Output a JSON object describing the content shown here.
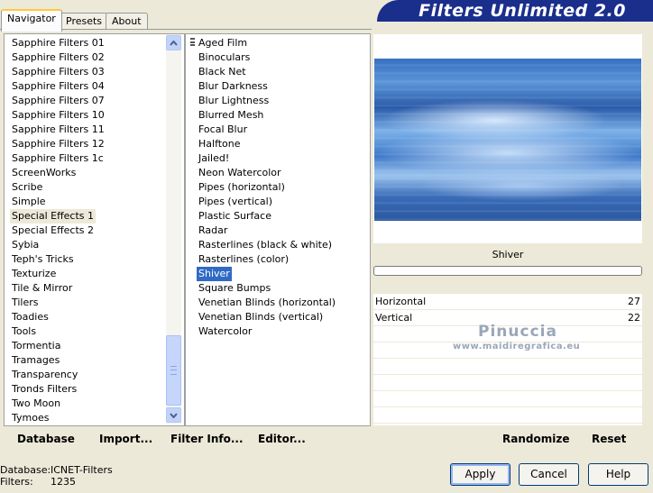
{
  "tabs": [
    {
      "label": "Navigator",
      "active": true
    },
    {
      "label": "Presets",
      "active": false
    },
    {
      "label": "About",
      "active": false
    }
  ],
  "banner_title": "Filters Unlimited 2.0",
  "categories": [
    "Sapphire Filters 01",
    "Sapphire Filters 02",
    "Sapphire Filters 03",
    "Sapphire Filters 04",
    "Sapphire Filters 07",
    "Sapphire Filters 10",
    "Sapphire Filters 11",
    "Sapphire Filters 12",
    "Sapphire Filters 1c",
    "ScreenWorks",
    "Scribe",
    "Simple",
    "Special Effects 1",
    "Special Effects 2",
    "Sybia",
    "Teph's Tricks",
    "Texturize",
    "Tile & Mirror",
    "Tilers",
    "Toadies",
    "Tools",
    "Tormentia",
    "Tramages",
    "Transparency",
    "Tronds Filters",
    "Two Moon",
    "Tymoes"
  ],
  "selected_category": "Special Effects 1",
  "filters": [
    "Aged Film",
    "Binoculars",
    "Black Net",
    "Blur Darkness",
    "Blur Lightness",
    "Blurred Mesh",
    "Focal Blur",
    "Halftone",
    "Jailed!",
    "Neon Watercolor",
    "Pipes (horizontal)",
    "Pipes (vertical)",
    "Plastic Surface",
    "Radar",
    "Rasterlines (black & white)",
    "Rasterlines (color)",
    "Shiver",
    "Square Bumps",
    "Venetian Blinds (horizontal)",
    "Venetian Blinds (vertical)",
    "Watercolor"
  ],
  "selected_filter": "Shiver",
  "toolbar": {
    "database": "Database",
    "import": "Import...",
    "filter_info": "Filter Info...",
    "editor": "Editor...",
    "randomize": "Randomize",
    "reset": "Reset"
  },
  "preview": {
    "filter_name": "Shiver"
  },
  "parameters": [
    {
      "name": "Horizontal",
      "value": "27"
    },
    {
      "name": "Vertical",
      "value": "22"
    }
  ],
  "watermark": {
    "line1": "Pinuccia",
    "line2": "www.maidiregrafica.eu"
  },
  "status": {
    "database_label": "Database:",
    "database_value": "ICNET-Filters",
    "filters_label": "Filters:",
    "filters_value": "1235"
  },
  "buttons": {
    "apply": "Apply",
    "cancel": "Cancel",
    "help": "Help"
  },
  "colors": {
    "banner": "#1a2e8c",
    "selection": "#316ac5",
    "tab_highlight": "#ffc83c"
  }
}
